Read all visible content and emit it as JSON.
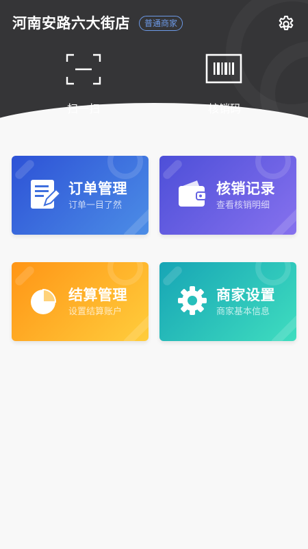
{
  "header": {
    "store_name": "河南安路六大街店",
    "merchant_type": "普通商家",
    "settings_icon": "gear-icon",
    "background_color": "#353537"
  },
  "actions": [
    {
      "label": "扫一扫",
      "icon": "scan-icon"
    },
    {
      "label": "核销码",
      "icon": "barcode-icon"
    }
  ],
  "cards": [
    {
      "title": "订单管理",
      "subtitle": "订单一目了然",
      "icon": "document-edit-icon",
      "colors": [
        "#2d52d6",
        "#4c8de6"
      ]
    },
    {
      "title": "核销记录",
      "subtitle": "查看核销明细",
      "icon": "wallet-icon",
      "colors": [
        "#4d4fd8",
        "#8671ee"
      ]
    },
    {
      "title": "结算管理",
      "subtitle": "设置结算账户",
      "icon": "pie-chart-icon",
      "colors": [
        "#ff9516",
        "#ffcd3c"
      ]
    },
    {
      "title": "商家设置",
      "subtitle": "商家基本信息",
      "icon": "gear-icon",
      "colors": [
        "#17a5b5",
        "#3fddbf"
      ]
    }
  ],
  "accent_badge_color": "#6d9ae8"
}
